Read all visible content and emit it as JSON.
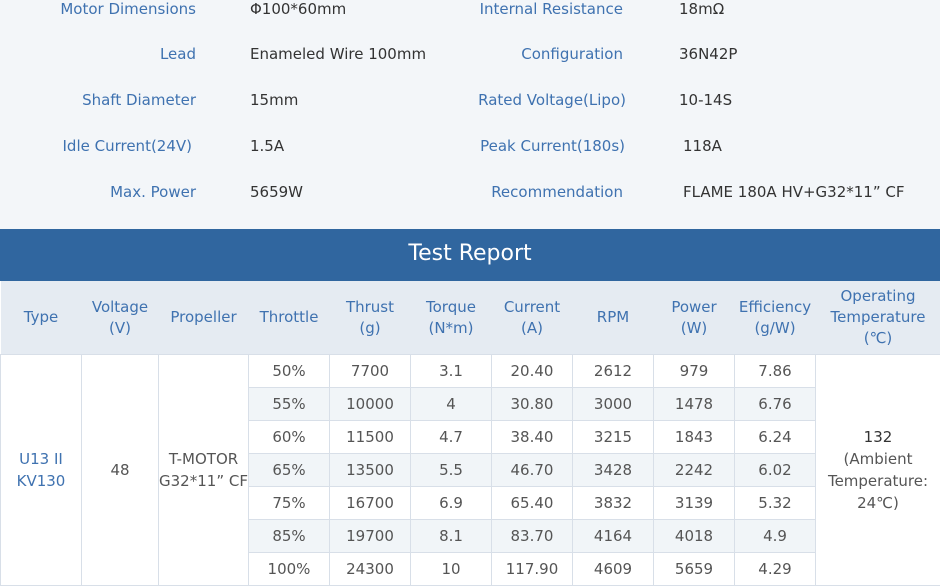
{
  "specs": {
    "left": [
      {
        "label": "Motor Dimensions",
        "value": "Φ100*60mm"
      },
      {
        "label": "Lead",
        "value": "Enameled Wire 100mm"
      },
      {
        "label": "Shaft Diameter",
        "value": "15mm"
      },
      {
        "label": "Idle Current(24V)",
        "value": "1.5A"
      },
      {
        "label": "Max. Power",
        "value": "5659W"
      }
    ],
    "right": [
      {
        "label": "Internal Resistance",
        "value": "18mΩ"
      },
      {
        "label": "Configuration",
        "value": "36N42P"
      },
      {
        "label": "Rated Voltage(Lipo)",
        "value": "10-14S"
      },
      {
        "label": "Peak Current(180s)",
        "value": "118A"
      },
      {
        "label": "Recommendation",
        "value": "FLAME 180A HV+G32*11” CF"
      }
    ]
  },
  "report": {
    "title": "Test Report",
    "headers": {
      "type": "Type",
      "voltage": [
        "Voltage",
        "(V)"
      ],
      "propeller": "Propeller",
      "throttle": "Throttle",
      "thrust": [
        "Thrust",
        "(g)"
      ],
      "torque": [
        "Torque",
        "(N*m)"
      ],
      "current": [
        "Current",
        "(A)"
      ],
      "rpm": "RPM",
      "power": [
        "Power",
        "(W)"
      ],
      "efficiency": [
        "Efficiency",
        "(g/W)"
      ],
      "temperature": [
        "Operating",
        "Temperature",
        "(℃)"
      ]
    },
    "type": [
      "U13 II",
      "KV130"
    ],
    "voltage": "48",
    "propeller": [
      "T-MOTOR",
      "G32*11” CF"
    ],
    "temperature": [
      "132",
      "(Ambient",
      "Temperature:",
      "24℃)"
    ],
    "rows": [
      {
        "throttle": "50%",
        "thrust": "7700",
        "torque": "3.1",
        "current": "20.40",
        "rpm": "2612",
        "power": "979",
        "efficiency": "7.86"
      },
      {
        "throttle": "55%",
        "thrust": "10000",
        "torque": "4",
        "current": "30.80",
        "rpm": "3000",
        "power": "1478",
        "efficiency": "6.76"
      },
      {
        "throttle": "60%",
        "thrust": "11500",
        "torque": "4.7",
        "current": "38.40",
        "rpm": "3215",
        "power": "1843",
        "efficiency": "6.24"
      },
      {
        "throttle": "65%",
        "thrust": "13500",
        "torque": "5.5",
        "current": "46.70",
        "rpm": "3428",
        "power": "2242",
        "efficiency": "6.02"
      },
      {
        "throttle": "75%",
        "thrust": "16700",
        "torque": "6.9",
        "current": "65.40",
        "rpm": "3832",
        "power": "3139",
        "efficiency": "5.32"
      },
      {
        "throttle": "85%",
        "thrust": "19700",
        "torque": "8.1",
        "current": "83.70",
        "rpm": "4164",
        "power": "4018",
        "efficiency": "4.9"
      },
      {
        "throttle": "100%",
        "thrust": "24300",
        "torque": "10",
        "current": "117.90",
        "rpm": "4609",
        "power": "5659",
        "efficiency": "4.29"
      }
    ]
  }
}
